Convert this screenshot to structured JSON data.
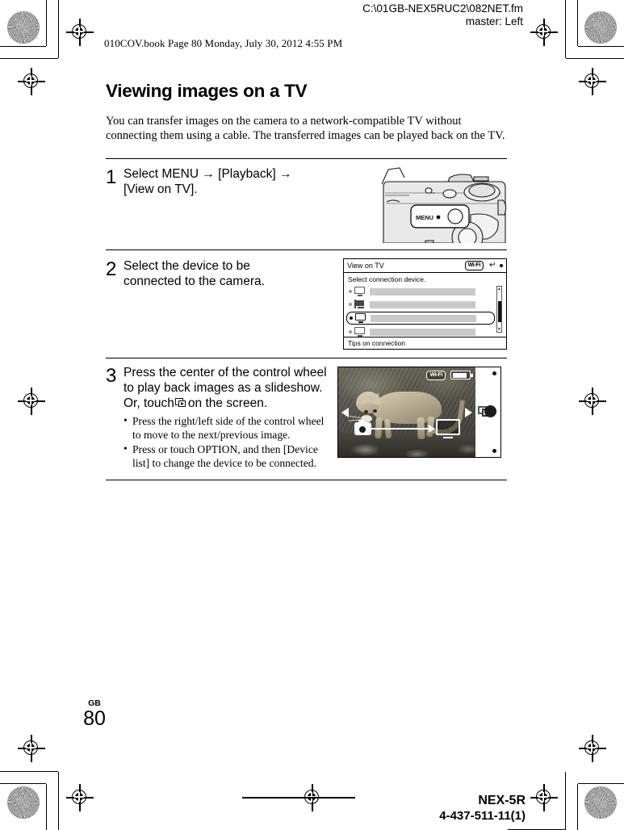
{
  "header": {
    "file_path": "C:\\01GB-NEX5RUC2\\082NET.fm",
    "master": "master: Left",
    "book_line": "010COV.book  Page 80  Monday, July 30, 2012  4:55 PM"
  },
  "page": {
    "title": "Viewing images on a TV",
    "intro": "You can transfer images on the camera to a network-compatible TV without connecting them using a cable. The transferred images can be played back on the TV."
  },
  "steps": [
    {
      "number": "1",
      "text": "Select MENU → [Playback] → [View on TV].",
      "figure": "camera-top-menu-button",
      "figure_label": "MENU"
    },
    {
      "number": "2",
      "text": "Select the device to be connected to the camera.",
      "figure": "view-on-tv-screen"
    },
    {
      "number": "3",
      "text_part_1": "Press the center of the control wheel to play back images as a slideshow. Or, touch",
      "text_part_2": "on the screen.",
      "bullets": [
        "Press the right/left side of the control wheel to move to the next/previous image.",
        "Press or touch OPTION, and then [Device list] to change the device to be connected."
      ],
      "figure": "playback-photo-screen"
    }
  ],
  "tv_screen": {
    "title": "View on TV",
    "wifi_badge": "Wi-Fi",
    "prompt": "Select connection device.",
    "footer": "Tips on connection",
    "devices": [
      {
        "icon": "tv-icon",
        "selected": false
      },
      {
        "icon": "projector-icon",
        "selected": false
      },
      {
        "icon": "tv-icon",
        "selected": true
      },
      {
        "icon": "tv-icon",
        "selected": false
      }
    ]
  },
  "photo_screen": {
    "wifi_badge": "Wi-Fi",
    "battery": "battery-icon",
    "subject": "cat-photo",
    "overlay_icons": [
      "camera-icon",
      "transfer-arrow",
      "tv-icon",
      "prev-arrow",
      "next-arrow",
      "slideshow-touch-icon"
    ]
  },
  "footer": {
    "region": "GB",
    "page_number": "80",
    "model": "NEX-5R",
    "part_code": "4-437-511-11(1)"
  }
}
